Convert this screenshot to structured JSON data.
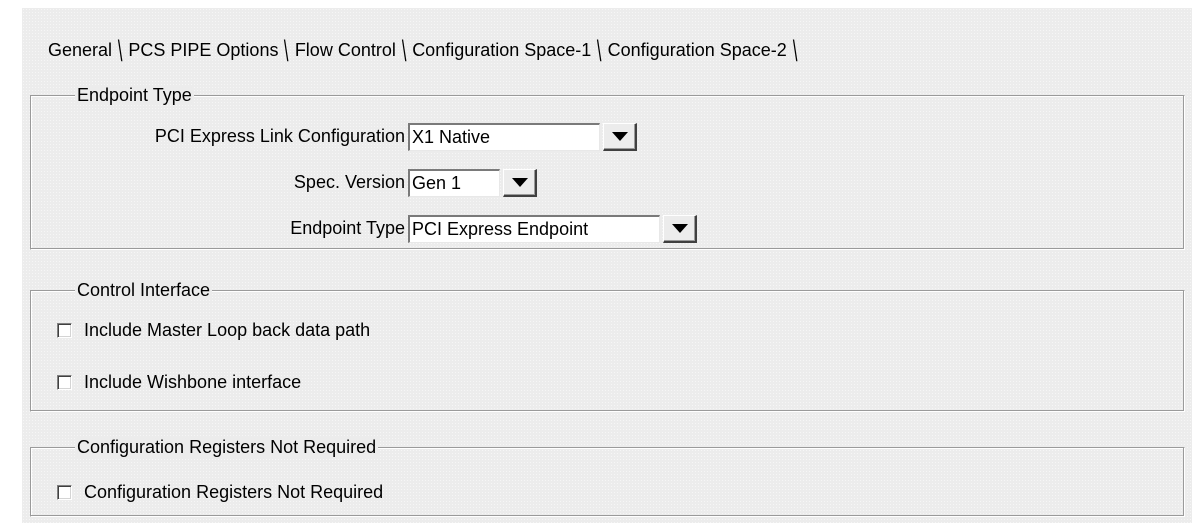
{
  "tabs": [
    {
      "label": "General"
    },
    {
      "label": "PCS PIPE Options"
    },
    {
      "label": "Flow Control"
    },
    {
      "label": "Configuration Space-1"
    },
    {
      "label": "Configuration Space-2"
    }
  ],
  "endpoint_group": {
    "legend": "Endpoint Type",
    "link_config": {
      "label": "PCI Express Link Configuration",
      "value": "X1 Native"
    },
    "spec_version": {
      "label": "Spec. Version",
      "value": "Gen 1"
    },
    "endpoint_type": {
      "label": "Endpoint Type",
      "value": "PCI Express Endpoint"
    }
  },
  "control_group": {
    "legend": "Control Interface",
    "master_loopback": {
      "label": "Include Master Loop back data path",
      "checked": false
    },
    "wishbone": {
      "label": "Include Wishbone interface",
      "checked": false
    }
  },
  "config_group": {
    "legend": "Configuration Registers Not Required",
    "config_not_required": {
      "label": "Configuration Registers Not Required",
      "checked": false
    }
  },
  "colors": {
    "panel_bg": "#ececec",
    "border_dark": "#9a9a9a"
  },
  "icons": {
    "dropdown": "chevron-down-icon",
    "tab_separator": "backslash-separator"
  }
}
